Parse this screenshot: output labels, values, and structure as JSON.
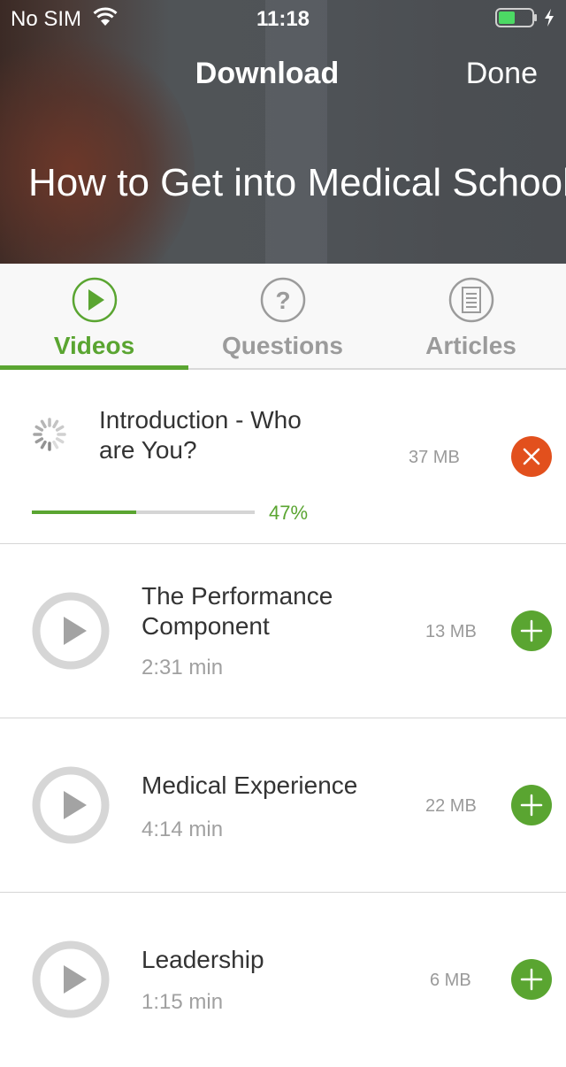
{
  "status_bar": {
    "carrier": "No SIM",
    "time": "11:18",
    "battery_color": "#4cd964"
  },
  "nav": {
    "title": "Download",
    "done_label": "Done"
  },
  "course": {
    "title": "How to Get into Medical School"
  },
  "tabs": [
    {
      "label": "Videos",
      "icon": "play-circle-icon",
      "active": true
    },
    {
      "label": "Questions",
      "icon": "question-circle-icon",
      "active": false
    },
    {
      "label": "Articles",
      "icon": "article-document-icon",
      "active": false
    }
  ],
  "downloading": {
    "title_line1": "Introduction - Who",
    "title_line2": "are You?",
    "size": "37 MB",
    "progress_label": "47%",
    "progress_fraction": 0.47
  },
  "videos": [
    {
      "title_line1": "The Performance",
      "title_line2": "Component",
      "duration": "2:31 min",
      "size": "13 MB"
    },
    {
      "title_line1": "Medical Experience",
      "title_line2": "",
      "duration": "4:14 min",
      "size": "22 MB"
    },
    {
      "title_line1": "Leadership",
      "title_line2": "",
      "duration": "1:15 min",
      "size": "6 MB"
    }
  ],
  "colors": {
    "accent": "#5aa531",
    "cancel": "#e2501d",
    "muted": "#9b9b9b"
  }
}
